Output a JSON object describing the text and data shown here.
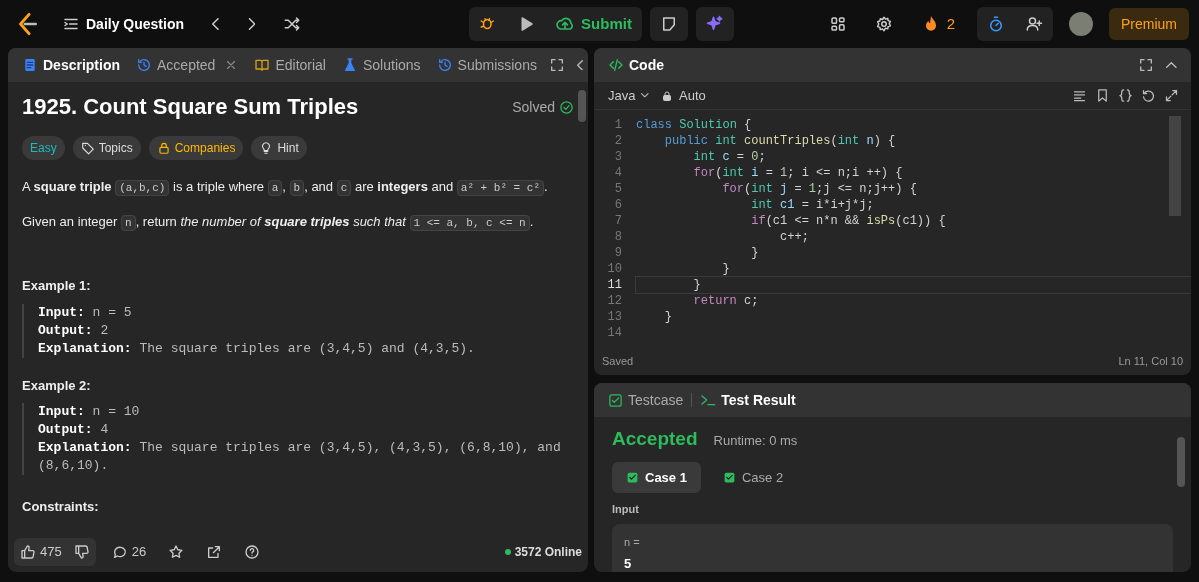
{
  "header": {
    "title": "Daily Question",
    "submit": "Submit",
    "streak": "2",
    "premium": "Premium"
  },
  "description_panel": {
    "tabs": [
      {
        "label": "Description",
        "kind": "document",
        "selected": true,
        "closable": false
      },
      {
        "label": "Accepted",
        "kind": "history",
        "selected": false,
        "closable": true
      },
      {
        "label": "Editorial",
        "kind": "book",
        "selected": false,
        "closable": false
      },
      {
        "label": "Solutions",
        "kind": "flask",
        "selected": false,
        "closable": false
      },
      {
        "label": "Submissions",
        "kind": "history",
        "selected": false,
        "closable": false
      }
    ],
    "title": "1925. Count Square Sum Triples",
    "status": "Solved",
    "tags": [
      {
        "label": "Easy",
        "kind": "difficulty"
      },
      {
        "label": "Topics",
        "kind": "topics"
      },
      {
        "label": "Companies",
        "kind": "locked"
      },
      {
        "label": "Hint",
        "kind": "hint"
      }
    ],
    "paragraphs": [
      [
        {
          "kind": "plain",
          "text": "A "
        },
        {
          "kind": "bold",
          "text": "square triple "
        },
        {
          "kind": "code",
          "text": "(a,b,c)"
        },
        {
          "kind": "plain",
          "text": " is a triple where "
        },
        {
          "kind": "code",
          "text": "a"
        },
        {
          "kind": "plain",
          "text": ", "
        },
        {
          "kind": "code",
          "text": "b"
        },
        {
          "kind": "plain",
          "text": ", and "
        },
        {
          "kind": "code",
          "text": "c"
        },
        {
          "kind": "plain",
          "text": " are "
        },
        {
          "kind": "bold",
          "text": "integers"
        },
        {
          "kind": "plain",
          "text": " and "
        },
        {
          "kind": "code",
          "text": "a² + b² = c²"
        },
        {
          "kind": "plain",
          "text": "."
        }
      ],
      [
        {
          "kind": "plain",
          "text": "Given an integer "
        },
        {
          "kind": "code",
          "text": "n"
        },
        {
          "kind": "plain",
          "text": ", return "
        },
        {
          "kind": "italic",
          "text": "the number of "
        },
        {
          "kind": "bolditalic",
          "text": "square triples"
        },
        {
          "kind": "italic",
          "text": " such that "
        },
        {
          "kind": "code",
          "text": "1 <= a, b, c <= n"
        },
        {
          "kind": "plain",
          "text": "."
        }
      ]
    ],
    "examples": [
      {
        "title": "Example 1:",
        "lines": [
          {
            "label": "Input:",
            "value": "n = 5"
          },
          {
            "label": "Output:",
            "value": "2"
          },
          {
            "label": "Explanation:",
            "value": "The square triples are (3,4,5) and (4,3,5)."
          }
        ]
      },
      {
        "title": "Example 2:",
        "lines": [
          {
            "label": "Input:",
            "value": "n = 10"
          },
          {
            "label": "Output:",
            "value": "4"
          },
          {
            "label": "Explanation:",
            "value": "The square triples are (3,4,5), (4,3,5), (6,8,10), and (8,6,10)."
          }
        ]
      }
    ],
    "constraints_heading": "Constraints:",
    "footer": {
      "likes": "475",
      "comments": "26",
      "online": "3572 Online"
    }
  },
  "code_panel": {
    "title": "Code",
    "language": "Java",
    "mode": "Auto",
    "lines": [
      {
        "number": "1",
        "current": false,
        "tokens": [
          {
            "kind": "storage",
            "text": "class "
          },
          {
            "kind": "type",
            "text": "Solution"
          },
          {
            "kind": "plain",
            "text": " {"
          }
        ]
      },
      {
        "number": "2",
        "current": false,
        "tokens": [
          {
            "kind": "storage",
            "text": "    public "
          },
          {
            "kind": "type",
            "text": "int "
          },
          {
            "kind": "func",
            "text": "countTriples"
          },
          {
            "kind": "plain",
            "text": "("
          },
          {
            "kind": "type",
            "text": "int "
          },
          {
            "kind": "var",
            "text": "n"
          },
          {
            "kind": "plain",
            "text": ") {"
          }
        ]
      },
      {
        "number": "3",
        "current": false,
        "tokens": [
          {
            "kind": "type",
            "text": "        int "
          },
          {
            "kind": "var",
            "text": "c"
          },
          {
            "kind": "plain",
            "text": " = "
          },
          {
            "kind": "num",
            "text": "0"
          },
          {
            "kind": "plain",
            "text": ";"
          }
        ]
      },
      {
        "number": "4",
        "current": false,
        "tokens": [
          {
            "kind": "control",
            "text": "        for"
          },
          {
            "kind": "plain",
            "text": "("
          },
          {
            "kind": "type",
            "text": "int "
          },
          {
            "kind": "var",
            "text": "i"
          },
          {
            "kind": "plain",
            "text": " = "
          },
          {
            "kind": "num",
            "text": "1"
          },
          {
            "kind": "plain",
            "text": "; i <= n;i ++) {"
          }
        ]
      },
      {
        "number": "5",
        "current": false,
        "tokens": [
          {
            "kind": "control",
            "text": "            for"
          },
          {
            "kind": "plain",
            "text": "("
          },
          {
            "kind": "type",
            "text": "int "
          },
          {
            "kind": "var",
            "text": "j"
          },
          {
            "kind": "plain",
            "text": " = "
          },
          {
            "kind": "num",
            "text": "1"
          },
          {
            "kind": "plain",
            "text": ";j <= n;j++) {"
          }
        ]
      },
      {
        "number": "6",
        "current": false,
        "tokens": [
          {
            "kind": "type",
            "text": "                int "
          },
          {
            "kind": "var",
            "text": "c1"
          },
          {
            "kind": "plain",
            "text": " = i*i+j*j;"
          }
        ]
      },
      {
        "number": "7",
        "current": false,
        "tokens": [
          {
            "kind": "control",
            "text": "                if"
          },
          {
            "kind": "plain",
            "text": "(c1 <= n*n && "
          },
          {
            "kind": "func",
            "text": "isPs"
          },
          {
            "kind": "plain",
            "text": "(c1)) {"
          }
        ]
      },
      {
        "number": "8",
        "current": false,
        "tokens": [
          {
            "kind": "plain",
            "text": "                    c++;"
          }
        ]
      },
      {
        "number": "9",
        "current": false,
        "tokens": [
          {
            "kind": "plain",
            "text": "                }"
          }
        ]
      },
      {
        "number": "10",
        "current": false,
        "tokens": [
          {
            "kind": "plain",
            "text": "            }"
          }
        ]
      },
      {
        "number": "11",
        "current": true,
        "tokens": [
          {
            "kind": "plain",
            "text": "        }"
          }
        ]
      },
      {
        "number": "12",
        "current": false,
        "tokens": [
          {
            "kind": "control",
            "text": "        return "
          },
          {
            "kind": "plain",
            "text": "c;"
          }
        ]
      },
      {
        "number": "13",
        "current": false,
        "tokens": [
          {
            "kind": "plain",
            "text": "    }"
          }
        ]
      },
      {
        "number": "14",
        "current": false
      }
    ],
    "save_status": "Saved",
    "cursor": "Ln 11, Col 10"
  },
  "result_panel": {
    "tabs": [
      {
        "label": "Testcase",
        "kind": "testcase",
        "selected": false
      },
      {
        "label": "Test Result",
        "kind": "terminal",
        "selected": true
      }
    ],
    "verdict": "Accepted",
    "runtime": "Runtime: 0 ms",
    "cases": [
      {
        "label": "Case 1",
        "selected": true,
        "passed": true
      },
      {
        "label": "Case 2",
        "selected": false,
        "passed": true
      }
    ],
    "input_label": "Input",
    "input_name": "n =",
    "input_value": "5"
  }
}
